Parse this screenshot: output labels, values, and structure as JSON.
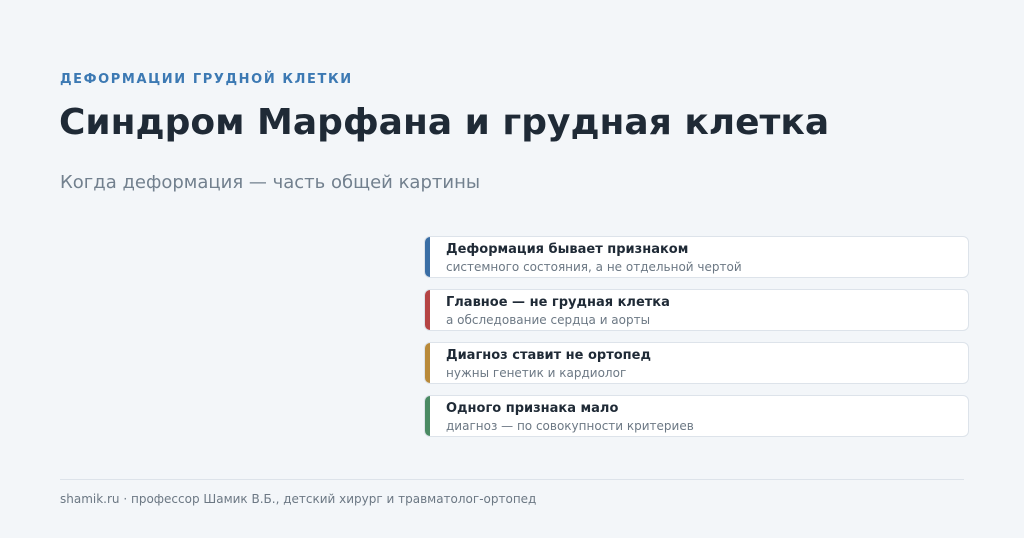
{
  "header": {
    "eyebrow": "ДЕФОРМАЦИИ ГРУДНОЙ КЛЕТКИ",
    "title": "Синдром Марфана и грудная клетка",
    "subtitle": "Когда деформация — часть общей картины"
  },
  "cards": [
    {
      "title": "Деформация бывает признаком",
      "subtitle": "системного состояния, а не отдельной чертой",
      "accent_color": "#3a6ea5"
    },
    {
      "title": "Главное — не грудная клетка",
      "subtitle": "а обследование сердца и аорты",
      "accent_color": "#b54444"
    },
    {
      "title": "Диагноз ставит не ортопед",
      "subtitle": "нужны генетик и кардиолог",
      "accent_color": "#b98a3a"
    },
    {
      "title": "Одного признака мало",
      "subtitle": "диагноз — по совокупности критериев",
      "accent_color": "#4a8a63"
    }
  ],
  "footer": {
    "text": "shamik.ru · профессор Шамик В.Б., детский хирург и травматолог-ортопед"
  }
}
